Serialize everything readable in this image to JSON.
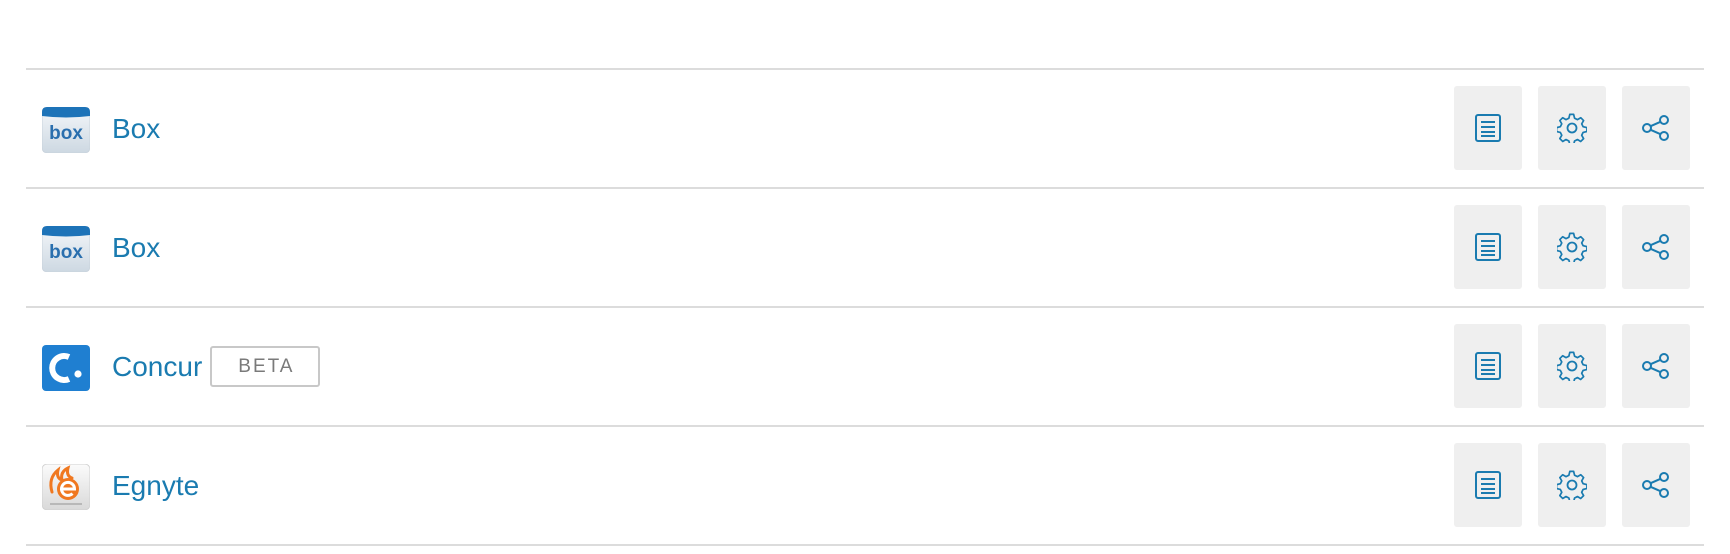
{
  "apps": [
    {
      "name": "Box",
      "icon": "box-logo-icon",
      "beta": ""
    },
    {
      "name": "Box",
      "icon": "box-logo-icon",
      "beta": ""
    },
    {
      "name": "Concur",
      "icon": "concur-logo-icon",
      "beta": "BETA"
    },
    {
      "name": "Egnyte",
      "icon": "egnyte-logo-icon",
      "beta": ""
    }
  ],
  "actions": {
    "details_icon": "list-details-icon",
    "settings_icon": "gear-icon",
    "share_icon": "share-icon"
  },
  "colors": {
    "link": "#1a7bb0",
    "divider": "#dcdcdc",
    "action_bg": "#efefef",
    "concur_blue": "#1f7fd1",
    "egnyte_orange": "#f07820"
  },
  "logo_text": {
    "box": "box",
    "concur": "C."
  }
}
